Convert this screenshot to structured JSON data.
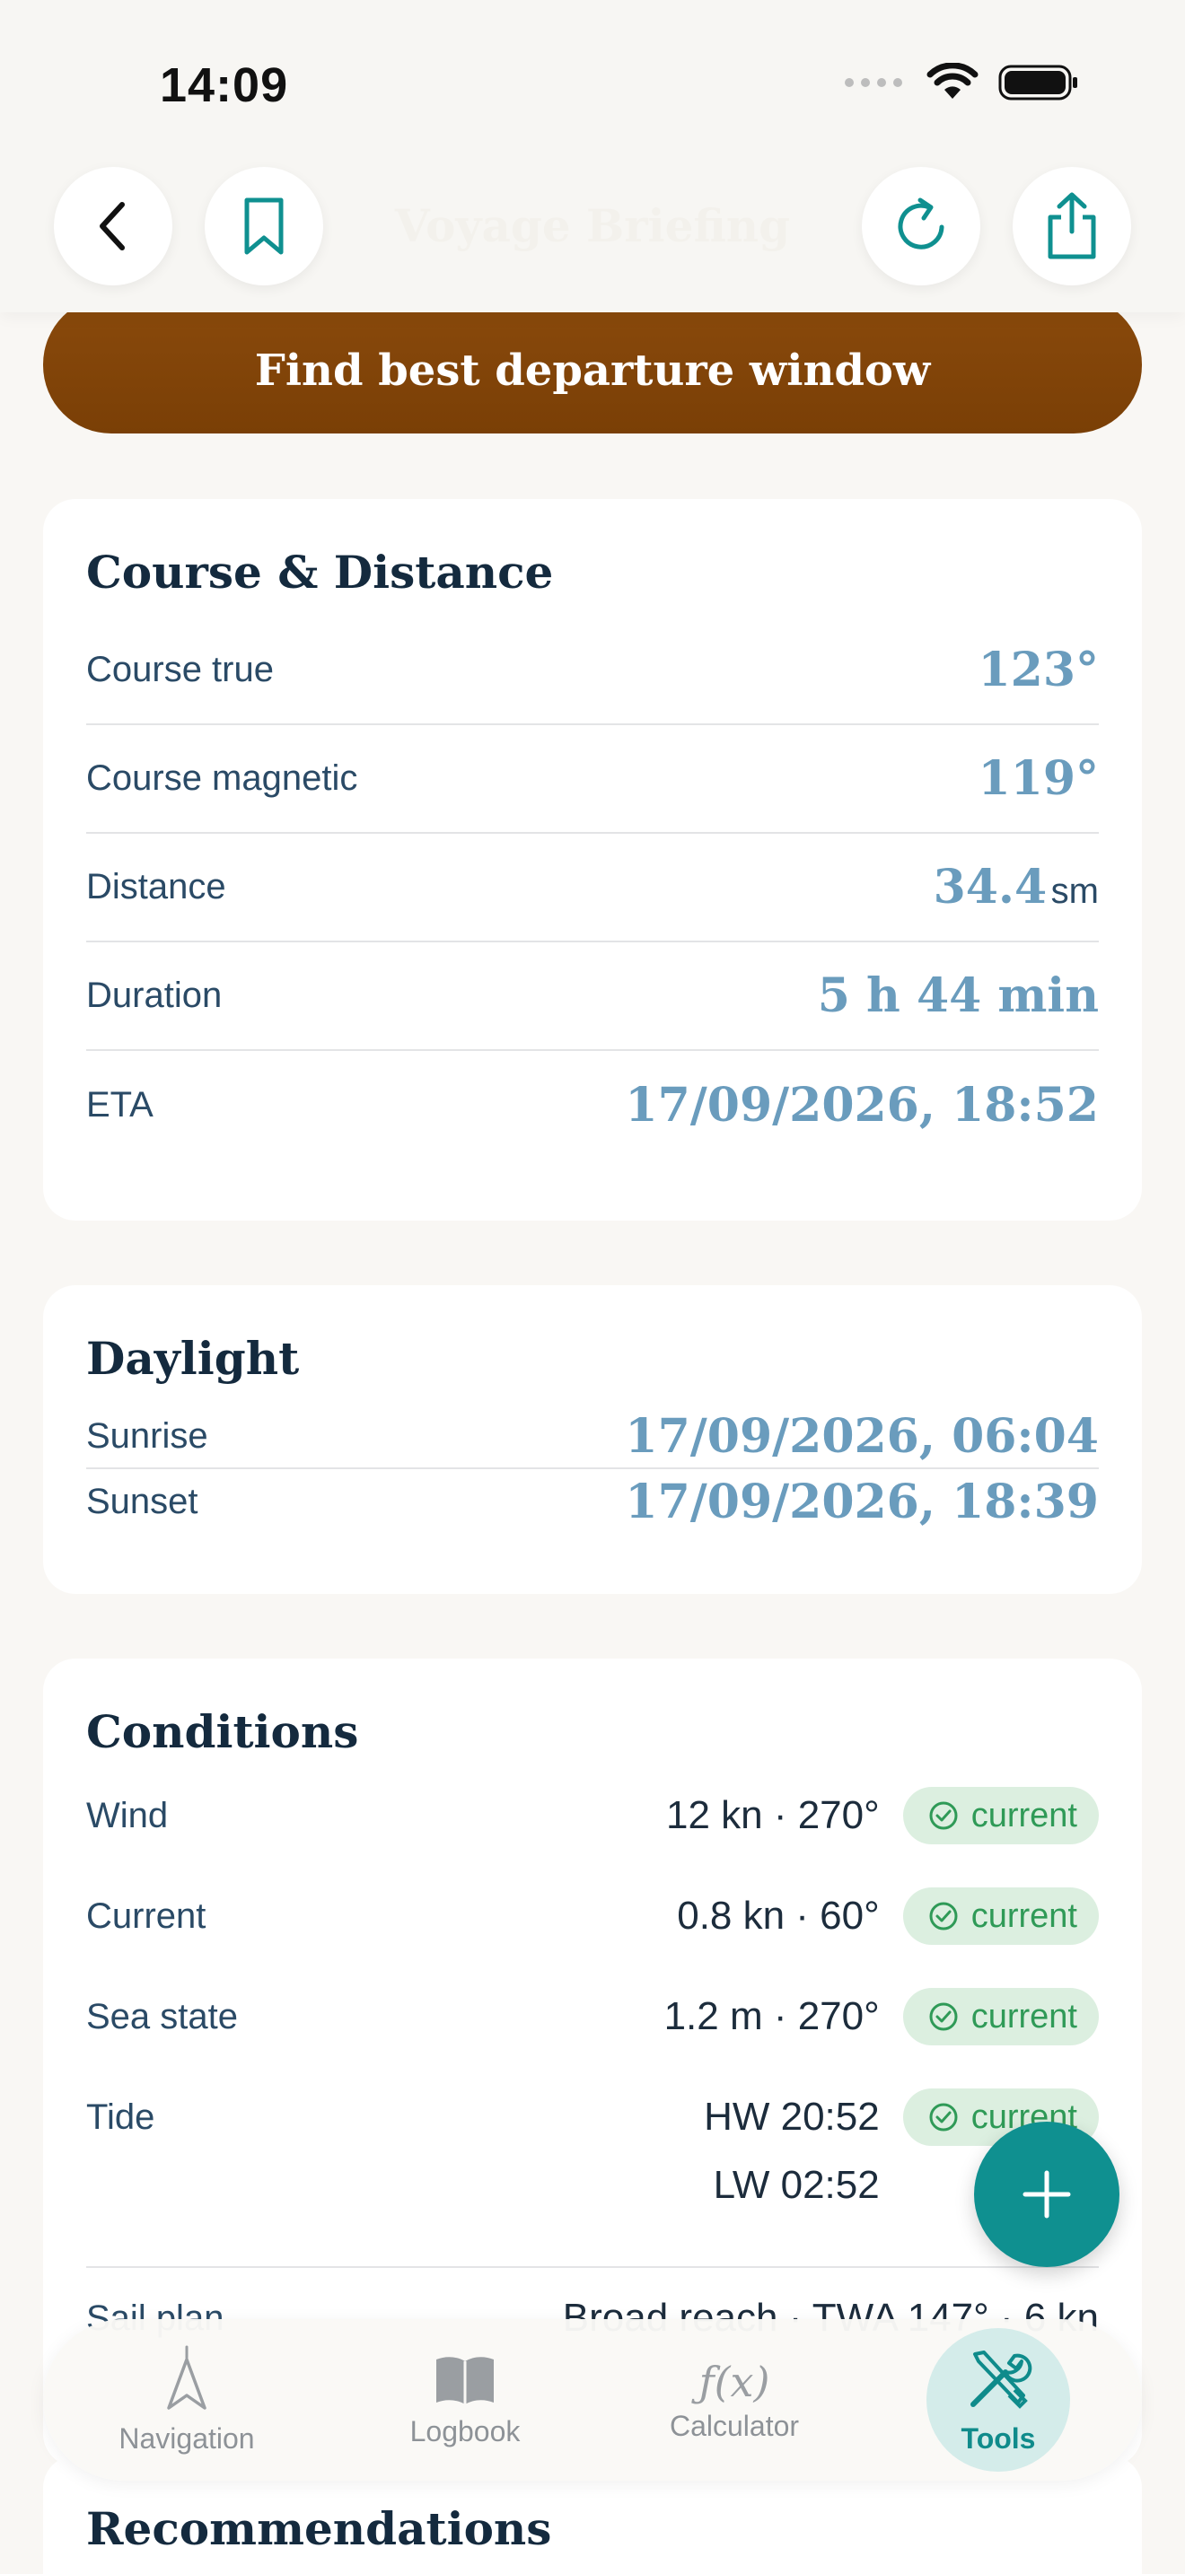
{
  "status_bar": {
    "time": "14:09"
  },
  "header": {
    "title": "Voyage Briefing"
  },
  "cta": {
    "label": "Find best departure window"
  },
  "course_card": {
    "title": "Course & Distance",
    "rows": [
      {
        "label": "Course true",
        "value": "123°",
        "unit": ""
      },
      {
        "label": "Course magnetic",
        "value": "119°",
        "unit": ""
      },
      {
        "label": "Distance",
        "value": "34.4",
        "unit": "sm"
      },
      {
        "label": "Duration",
        "value": "5 h 44 min",
        "unit": ""
      },
      {
        "label": "ETA",
        "value": "17/09/2026, 18:52",
        "unit": ""
      }
    ]
  },
  "daylight_card": {
    "title": "Daylight",
    "rows": [
      {
        "label": "Sunrise",
        "value": "17/09/2026, 06:04"
      },
      {
        "label": "Sunset",
        "value": "17/09/2026, 18:39"
      }
    ]
  },
  "conditions_card": {
    "title": "Conditions",
    "rows": [
      {
        "label": "Wind",
        "value": "12 kn · 270°",
        "badge": "current"
      },
      {
        "label": "Current",
        "value": "0.8 kn · 60°",
        "badge": "current"
      },
      {
        "label": "Sea state",
        "value": "1.2 m · 270°",
        "badge": "current"
      },
      {
        "label": "Tide",
        "value": "HW 20:52",
        "value2": "LW 02:52",
        "badge": "current"
      }
    ],
    "sail_plan": {
      "label": "Sail plan",
      "value": "Broad reach · TWA 147° · 6 kn"
    }
  },
  "recommendations": {
    "title": "Recommendations"
  },
  "bottom_nav": {
    "items": [
      {
        "label": "Navigation",
        "icon": "navigation-arrow-icon"
      },
      {
        "label": "Logbook",
        "icon": "book-icon"
      },
      {
        "label": "Calculator",
        "icon": "function-icon",
        "glyph": "ƒ(x)"
      },
      {
        "label": "Tools",
        "icon": "tools-icon",
        "active": true
      }
    ]
  },
  "colors": {
    "accent": "#0f9090",
    "cta": "#7f4207",
    "value": "#6a9cbd",
    "badge_bg": "#dcefe0",
    "badge_fg": "#2f9a57"
  }
}
